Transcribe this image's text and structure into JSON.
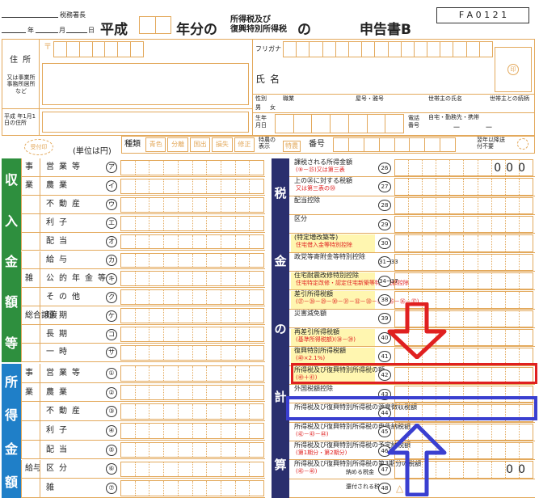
{
  "header": {
    "tax_office": "税務署長",
    "date_year": "年",
    "date_month": "月",
    "date_day": "日",
    "era": "平成",
    "year_suffix": "年分の",
    "tax_name_line1": "所得税及び",
    "tax_name_line2": "復興特別所得税",
    "tax_name_no": "の",
    "form_title": "申告書B",
    "form_code": "F A 0 1 2 1"
  },
  "address": {
    "postal_mark": "〒",
    "label_address": "住所",
    "label_alt": "又は事業所事務所居所など",
    "label_jan1": "平成 年1月1日の住所",
    "furigana_label": "フリガナ",
    "name_label": "氏名",
    "gender_label": "性別",
    "male": "男",
    "female": "女",
    "occupation": "職業",
    "trade_name": "屋号・雅号",
    "household_head": "世帯主の氏名",
    "relationship": "世帯主との続柄",
    "birthdate": "生年月日",
    "phone_label": "電話番号",
    "phone_types": "自宅・勤務先・携帯",
    "phone_dashes": "－　　　－"
  },
  "meta_row": {
    "received_stamp": "受付印",
    "unit": "(単位は円)",
    "kind_label": "種類",
    "kinds": [
      "青色",
      "分離",
      "国出",
      "損失",
      "修正"
    ],
    "special_label": "特農の表示",
    "special_value": "特農",
    "number_label": "番号",
    "next_year_note": "翌年以降送付不要"
  },
  "sections": {
    "income": "収入金額等",
    "income_chars": [
      "収",
      "入",
      "金",
      "額",
      "等"
    ],
    "shotoku": "所得金",
    "shotoku_chars": [
      "所",
      "得",
      "金",
      "額"
    ],
    "tax_calc_chars": [
      "税",
      "金",
      "の",
      "計",
      "算"
    ]
  },
  "income_rows": [
    {
      "group": "事",
      "label": "営業等",
      "mark": "ア"
    },
    {
      "group": "業",
      "label": "農業",
      "mark": "イ"
    },
    {
      "group": "",
      "label": "不動産",
      "mark": "ウ"
    },
    {
      "group": "",
      "label": "利子",
      "mark": "エ"
    },
    {
      "group": "",
      "label": "配当",
      "mark": "オ"
    },
    {
      "group": "",
      "label": "給与",
      "mark": "カ"
    },
    {
      "group": "雑",
      "label": "公的年金等",
      "mark": "キ"
    },
    {
      "group": "",
      "label": "その他",
      "mark": "ク"
    },
    {
      "group": "総合譲渡",
      "label": "短期",
      "mark": "ケ"
    },
    {
      "group": "",
      "label": "長期",
      "mark": "コ"
    },
    {
      "group": "",
      "label": "一時",
      "mark": "サ"
    }
  ],
  "income_right_labels": [
    "事",
    "業",
    "不",
    "利",
    "配",
    "給",
    "雑",
    "公的年金等",
    "その他",
    "総合譲渡",
    "短",
    "長",
    "一"
  ],
  "shotoku_rows": [
    {
      "group": "事",
      "label": "営業等",
      "mark": "①"
    },
    {
      "group": "業",
      "label": "農業",
      "mark": "②"
    },
    {
      "group": "",
      "label": "不動産",
      "mark": "③"
    },
    {
      "group": "",
      "label": "利子",
      "mark": "④"
    },
    {
      "group": "",
      "label": "配当",
      "mark": "⑤"
    },
    {
      "group": "給与",
      "label": "区分",
      "mark": "⑥"
    },
    {
      "group": "",
      "label": "雑",
      "mark": "⑦"
    }
  ],
  "tax_rows": [
    {
      "label": "課税される所得金額",
      "sub": "(⑨－㉕)又は第三表",
      "num": "26",
      "zeros": "000"
    },
    {
      "label": "上の㉖に対する税額",
      "sub": "又は第三表の㊿",
      "num": "27",
      "zeros": ""
    },
    {
      "label": "配当控除",
      "sub": "",
      "num": "28",
      "zeros": ""
    },
    {
      "label": "区分",
      "sub": "",
      "num": "29",
      "zeros": ""
    },
    {
      "label": "(特定増改築等)",
      "sub": "住宅借入金等特別控除",
      "num": "30",
      "zeros": ""
    },
    {
      "label": "政党等寄附金等特別控除",
      "sub": "",
      "num": "31~33",
      "zeros": ""
    },
    {
      "label": "住宅耐震改修特別控除",
      "sub": "住宅特定改修・認定住宅新築等特別税額控除",
      "num": "34~37",
      "zeros": ""
    },
    {
      "label": "差引所得税額",
      "sub": "(㉗－㉘－㉙－㉚－㉛－㉜－㉝－㉞－㉟－㊱－㊲)",
      "num": "38",
      "zeros": ""
    },
    {
      "label": "災害減免額",
      "sub": "",
      "num": "39",
      "zeros": ""
    },
    {
      "label": "再差引所得税額",
      "sub": "(基準所得税額)(㊳－㊴)",
      "num": "40",
      "zeros": ""
    },
    {
      "label": "復興特別所得税額",
      "sub": "(㊵×2.1%)",
      "num": "41",
      "zeros": ""
    },
    {
      "label": "所得税及び復興特別所得税の額",
      "sub": "(㊵＋㊶)",
      "num": "42",
      "zeros": ""
    },
    {
      "label": "外国税額控除",
      "sub": "",
      "num": "43",
      "zeros": ""
    },
    {
      "label": "所得税及び復興特別所得税の源泉徴収税額",
      "sub": "",
      "num": "44",
      "zeros": ""
    },
    {
      "label": "所得税及び復興特別所得税の申告納税額",
      "sub": "(㊷－㊸－㊹)",
      "num": "45",
      "zeros": ""
    },
    {
      "label": "所得税及び復興特別所得税の予定納税額",
      "sub": "(第1期分・第2期分)",
      "num": "46",
      "zeros": ""
    },
    {
      "label": "所得税及び復興特別所得税の第3期分の税額",
      "sub": "(㊺－㊻)",
      "num": "47",
      "zeros": "00"
    }
  ],
  "payment": {
    "pay_label": "納める税金",
    "refund_label": "還付される税金",
    "num47": "47",
    "num48": "48",
    "triangle": "△"
  },
  "colors": {
    "green": "#2e8f3e",
    "blue": "#1f7fc8",
    "navy": "#2a2f6e",
    "orange_line": "#e3a95c",
    "yellow": "#fff6b0",
    "red_highlight": "#e02020",
    "blue_highlight": "#3a3fd0"
  }
}
